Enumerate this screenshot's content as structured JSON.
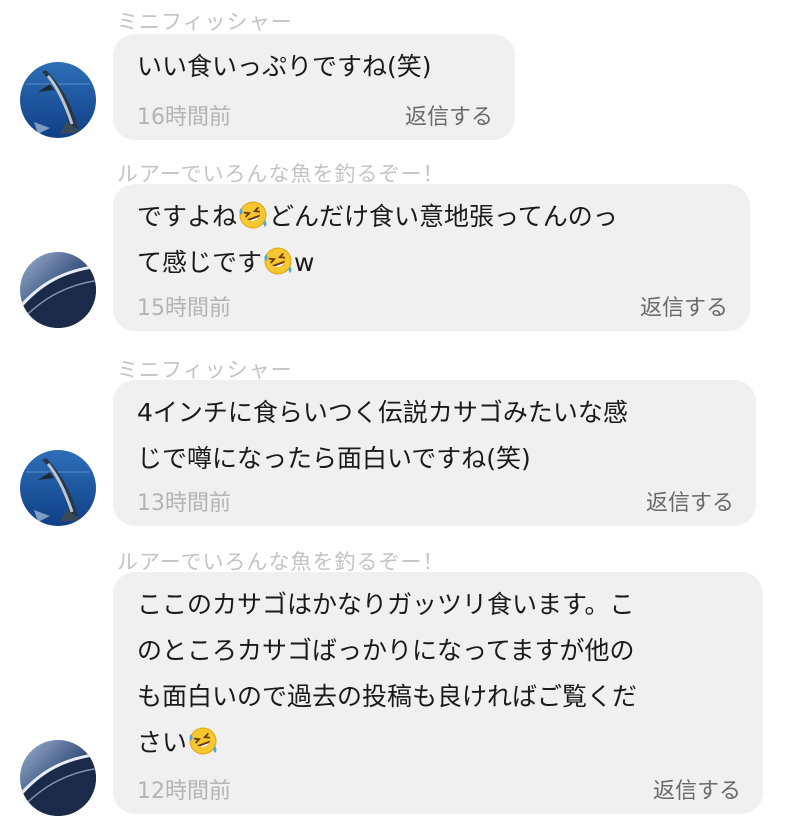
{
  "comments": [
    {
      "username": "ミニフィッシャー",
      "avatar": "marlin-avatar",
      "text_parts": [
        "いい食いっぷりですね(笑)"
      ],
      "time": "16時間前",
      "reply_label": "返信する"
    },
    {
      "username": "ルアーでいろんな魚を釣るぞー！",
      "avatar": "boat-avatar",
      "text_parts": [
        "ですよね",
        "どんだけ食い意地張ってんのっ\nて感じです",
        "w"
      ],
      "emoji": "rolling-laughing-emoji",
      "time": "15時間前",
      "reply_label": "返信する"
    },
    {
      "username": "ミニフィッシャー",
      "avatar": "marlin-avatar",
      "text_parts": [
        "4インチに食らいつく伝説カサゴみたいな感\nじで噂になったら面白いですね(笑)"
      ],
      "time": "13時間前",
      "reply_label": "返信する"
    },
    {
      "username": "ルアーでいろんな魚を釣るぞー！",
      "avatar": "boat-avatar",
      "text_parts": [
        "ここのカサゴはかなりガッツリ食います。こ\nのところカサゴばっかりになってますが他の\nも面白いので過去の投稿も良ければご覧くだ\nさい"
      ],
      "emoji": "rolling-laughing-emoji",
      "time": "12時間前",
      "reply_label": "返信する"
    }
  ]
}
